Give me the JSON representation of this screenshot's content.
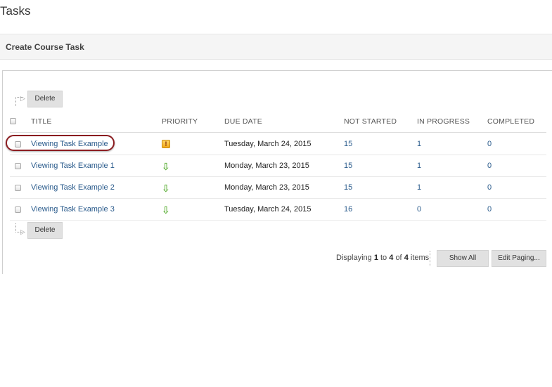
{
  "page": {
    "title": "Tasks"
  },
  "action_bar": {
    "create_label": "Create Course Task"
  },
  "toolbar": {
    "delete_label": "Delete"
  },
  "table": {
    "headers": {
      "title": "TITLE",
      "priority": "PRIORITY",
      "due_date": "DUE DATE",
      "not_started": "NOT STARTED",
      "in_progress": "IN PROGRESS",
      "completed": "COMPLETED"
    },
    "rows": [
      {
        "title": "Viewing Task Example",
        "priority": "high",
        "due_date": "Tuesday, March 24, 2015",
        "not_started": "15",
        "in_progress": "1",
        "completed": "0"
      },
      {
        "title": "Viewing Task Example 1",
        "priority": "low",
        "due_date": "Monday, March 23, 2015",
        "not_started": "15",
        "in_progress": "1",
        "completed": "0"
      },
      {
        "title": "Viewing Task Example 2",
        "priority": "low",
        "due_date": "Monday, March 23, 2015",
        "not_started": "15",
        "in_progress": "1",
        "completed": "0"
      },
      {
        "title": "Viewing Task Example 3",
        "priority": "low",
        "due_date": "Tuesday, March 24, 2015",
        "not_started": "16",
        "in_progress": "0",
        "completed": "0"
      }
    ],
    "highlighted_row_index": 0
  },
  "paging": {
    "prefix": "Displaying",
    "from": "1",
    "to_word": "to",
    "to": "4",
    "of_word": "of",
    "total": "4",
    "suffix": "items",
    "show_all_label": "Show All",
    "edit_paging_label": "Edit Paging..."
  },
  "icons": {
    "priority_high": "exclamation-icon",
    "priority_low": "down-arrow-icon"
  },
  "colors": {
    "link": "#2a5b8c",
    "highlight_ring": "#8b1c20",
    "priority_low": "#5fb13b",
    "priority_high": "#f2a91b"
  }
}
